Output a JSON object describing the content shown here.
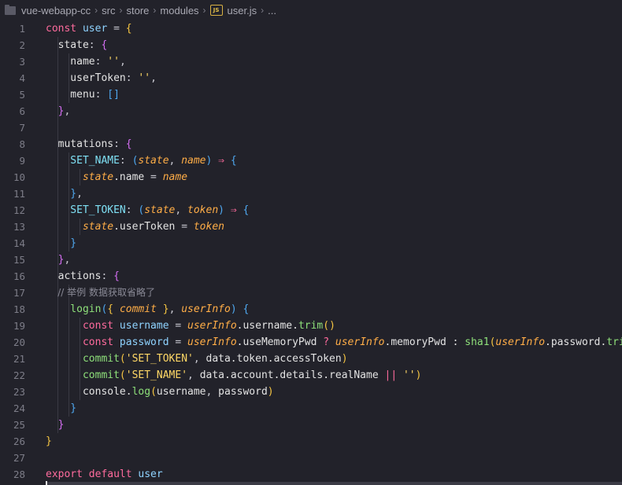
{
  "breadcrumb": {
    "items": [
      "vue-webapp-cc",
      "src",
      "store",
      "modules",
      "user.js",
      "..."
    ],
    "file_badge": "JS"
  },
  "editor": {
    "lines": [
      {
        "n": "1",
        "tokens": [
          [
            "kw",
            "const "
          ],
          [
            "id",
            "user"
          ],
          [
            "pun",
            " = "
          ],
          [
            "br1",
            "{"
          ]
        ]
      },
      {
        "n": "2",
        "tokens": [
          [
            "plain",
            "  state"
          ],
          [
            "pun",
            ": "
          ],
          [
            "br2",
            "{"
          ]
        ]
      },
      {
        "n": "3",
        "tokens": [
          [
            "plain",
            "    name"
          ],
          [
            "pun",
            ": "
          ],
          [
            "str",
            "''"
          ],
          [
            "pun",
            ","
          ]
        ]
      },
      {
        "n": "4",
        "tokens": [
          [
            "plain",
            "    userToken"
          ],
          [
            "pun",
            ": "
          ],
          [
            "str",
            "''"
          ],
          [
            "pun",
            ","
          ]
        ]
      },
      {
        "n": "5",
        "tokens": [
          [
            "plain",
            "    menu"
          ],
          [
            "pun",
            ": "
          ],
          [
            "br3",
            "[]"
          ]
        ]
      },
      {
        "n": "6",
        "tokens": [
          [
            "br2",
            "  }"
          ],
          [
            "pun",
            ","
          ]
        ]
      },
      {
        "n": "7",
        "tokens": []
      },
      {
        "n": "8",
        "tokens": [
          [
            "plain",
            "  mutations"
          ],
          [
            "pun",
            ": "
          ],
          [
            "br2",
            "{"
          ]
        ]
      },
      {
        "n": "9",
        "tokens": [
          [
            "cyan",
            "    SET_NAME"
          ],
          [
            "pun",
            ": "
          ],
          [
            "br3",
            "("
          ],
          [
            "param",
            "state"
          ],
          [
            "pun",
            ", "
          ],
          [
            "param",
            "name"
          ],
          [
            "br3",
            ")"
          ],
          [
            "arrow",
            " ⇒ "
          ],
          [
            "br3",
            "{"
          ]
        ]
      },
      {
        "n": "10",
        "tokens": [
          [
            "param",
            "      state"
          ],
          [
            "plain",
            ".name"
          ],
          [
            "pun",
            " = "
          ],
          [
            "param",
            "name"
          ]
        ]
      },
      {
        "n": "11",
        "tokens": [
          [
            "br3",
            "    }"
          ],
          [
            "pun",
            ","
          ]
        ]
      },
      {
        "n": "12",
        "tokens": [
          [
            "cyan",
            "    SET_TOKEN"
          ],
          [
            "pun",
            ": "
          ],
          [
            "br3",
            "("
          ],
          [
            "param",
            "state"
          ],
          [
            "pun",
            ", "
          ],
          [
            "param",
            "token"
          ],
          [
            "br3",
            ")"
          ],
          [
            "arrow",
            " ⇒ "
          ],
          [
            "br3",
            "{"
          ]
        ]
      },
      {
        "n": "13",
        "tokens": [
          [
            "param",
            "      state"
          ],
          [
            "plain",
            ".userToken"
          ],
          [
            "pun",
            " = "
          ],
          [
            "param",
            "token"
          ]
        ]
      },
      {
        "n": "14",
        "tokens": [
          [
            "br3",
            "    }"
          ]
        ]
      },
      {
        "n": "15",
        "tokens": [
          [
            "br2",
            "  }"
          ],
          [
            "pun",
            ","
          ]
        ]
      },
      {
        "n": "16",
        "tokens": [
          [
            "plain",
            "  actions"
          ],
          [
            "pun",
            ": "
          ],
          [
            "br2",
            "{"
          ]
        ]
      },
      {
        "n": "17",
        "tokens": [
          [
            "cmt",
            "    // 举例 数据获取省略了"
          ]
        ]
      },
      {
        "n": "18",
        "tokens": [
          [
            "fn",
            "    login"
          ],
          [
            "br3",
            "("
          ],
          [
            "br1",
            "{ "
          ],
          [
            "param",
            "commit"
          ],
          [
            "br1",
            " }"
          ],
          [
            "pun",
            ", "
          ],
          [
            "param",
            "userInfo"
          ],
          [
            "br3",
            ")"
          ],
          [
            "br3",
            " {"
          ]
        ]
      },
      {
        "n": "19",
        "tokens": [
          [
            "kw",
            "      const "
          ],
          [
            "id",
            "username"
          ],
          [
            "pun",
            " = "
          ],
          [
            "param",
            "userInfo"
          ],
          [
            "plain",
            ".username."
          ],
          [
            "fn",
            "trim"
          ],
          [
            "br1",
            "()"
          ]
        ]
      },
      {
        "n": "20",
        "tokens": [
          [
            "kw",
            "      const "
          ],
          [
            "id",
            "password"
          ],
          [
            "pun",
            " = "
          ],
          [
            "param",
            "userInfo"
          ],
          [
            "plain",
            ".useMemoryPwd "
          ],
          [
            "kw",
            "?"
          ],
          [
            "plain",
            " "
          ],
          [
            "param",
            "userInfo"
          ],
          [
            "plain",
            ".memoryPwd : "
          ],
          [
            "fn",
            "sha1"
          ],
          [
            "br1",
            "("
          ],
          [
            "param",
            "userInfo"
          ],
          [
            "plain",
            ".password."
          ],
          [
            "fn",
            "trim"
          ],
          [
            "br2",
            "()"
          ],
          [
            "br1",
            ")"
          ]
        ]
      },
      {
        "n": "21",
        "tokens": [
          [
            "fn",
            "      commit"
          ],
          [
            "br1",
            "("
          ],
          [
            "str",
            "'SET_TOKEN'"
          ],
          [
            "pun",
            ", "
          ],
          [
            "plain",
            "data.token.accessToken"
          ],
          [
            "br1",
            ")"
          ]
        ]
      },
      {
        "n": "22",
        "tokens": [
          [
            "fn",
            "      commit"
          ],
          [
            "br1",
            "("
          ],
          [
            "str",
            "'SET_NAME'"
          ],
          [
            "pun",
            ", "
          ],
          [
            "plain",
            "data.account.details.realName "
          ],
          [
            "kw",
            "||"
          ],
          [
            "plain",
            " "
          ],
          [
            "str",
            "''"
          ],
          [
            "br1",
            ")"
          ]
        ]
      },
      {
        "n": "23",
        "tokens": [
          [
            "plain",
            "      console."
          ],
          [
            "fn",
            "log"
          ],
          [
            "br1",
            "("
          ],
          [
            "plain",
            "username"
          ],
          [
            "pun",
            ", "
          ],
          [
            "plain",
            "password"
          ],
          [
            "br1",
            ")"
          ]
        ]
      },
      {
        "n": "24",
        "tokens": [
          [
            "br3",
            "    }"
          ]
        ]
      },
      {
        "n": "25",
        "tokens": [
          [
            "br2",
            "  }"
          ]
        ]
      },
      {
        "n": "26",
        "tokens": [
          [
            "br1",
            "}"
          ]
        ]
      },
      {
        "n": "27",
        "tokens": []
      },
      {
        "n": "28",
        "tokens": [
          [
            "kw",
            "export default "
          ],
          [
            "id",
            "user"
          ]
        ]
      }
    ]
  }
}
